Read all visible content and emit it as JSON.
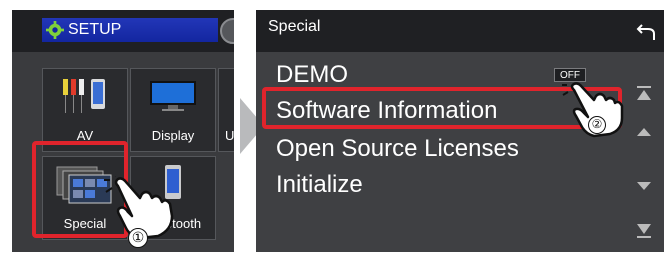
{
  "left": {
    "title": "SETUP",
    "tiles": [
      {
        "label": "AV"
      },
      {
        "label": "Display"
      },
      {
        "label": "U"
      },
      {
        "label": "Special"
      },
      {
        "label": "etooth"
      }
    ],
    "step_marker": "①"
  },
  "right": {
    "title": "Special",
    "items": [
      {
        "label": "DEMO"
      },
      {
        "label": "Software Information"
      },
      {
        "label": "Open Source Licenses"
      },
      {
        "label": "Initialize"
      }
    ],
    "demo_toggle": "OFF",
    "step_marker": "②"
  },
  "colors": {
    "highlight": "#e0242c",
    "title_bar": "#1f2023",
    "setup_badge": "#1326a0"
  }
}
